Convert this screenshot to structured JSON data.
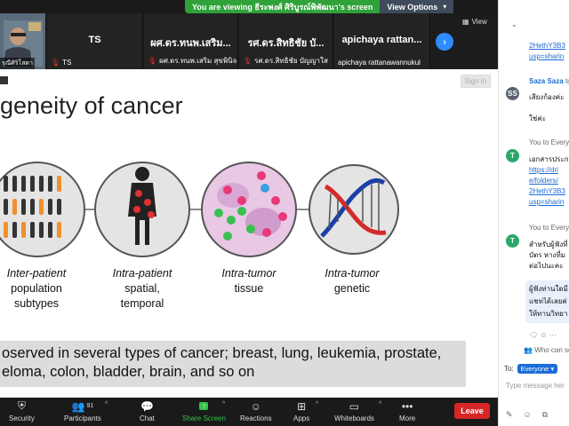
{
  "banner": {
    "text": "You are viewing ธีระพงศ์ ศิริบูรณ์พิพัฒนา's screen",
    "options": "View Options"
  },
  "participants": [
    {
      "name_big": "",
      "label": "",
      "cam_label": "รุณีศิริโสดา"
    },
    {
      "name_big": "TS",
      "label": "TS"
    },
    {
      "name_big": "ผศ.ดร.ทนพ.เสริม...",
      "label": "ผศ.ดร.ทนพ.เสริม สุขพินิจ"
    },
    {
      "name_big": "รศ.ดร.สิทธิชัย บั...",
      "label": "รศ.ดร.สิทธิชัย บัญญาใส"
    },
    {
      "name_big": "apichaya rattan...",
      "label": "apichaya rattanawannukul"
    }
  ],
  "view_label": "View",
  "slide": {
    "sign_in": "Sign in",
    "title": "geneity of cancer",
    "captions": [
      {
        "line1": "Inter-patient",
        "line2": "population",
        "line3": "subtypes"
      },
      {
        "line1": "Intra-patient",
        "line2": "spatial,",
        "line3": "temporal"
      },
      {
        "line1": "Intra-tumor",
        "line2": "tissue",
        "line3": ""
      },
      {
        "line1": "Intra-tumor",
        "line2": "genetic",
        "line3": ""
      }
    ],
    "bottom_line1": "oserved in several types of cancer; breast, lung, leukemia, prostate,",
    "bottom_line2": "eloma, colon, bladder, brain, and so on"
  },
  "toolbar": {
    "security": "Security",
    "participants": "Participants",
    "participants_count": "91",
    "chat": "Chat",
    "share": "Share Screen",
    "reactions": "Reactions",
    "apps": "Apps",
    "whiteboards": "Whiteboards",
    "more": "More",
    "leave": "Leave"
  },
  "chat": {
    "link1a": "2HethY3B3",
    "link1b": "usp=sharin",
    "sender1": "Saza Saza",
    "sender1_to": "to",
    "avatar1": "SS",
    "msg1": "เสียงก้องค่ะ",
    "msg2": "ใช่ค่ะ",
    "you_to1": "You to Every",
    "avatar2": "T",
    "msg3": "เอกสารประก",
    "link2a": "https://dri",
    "link2b": "e/folders/",
    "link2c": "2HethY3B3",
    "link2d": "usp=sharin",
    "you_to2": "You to Every",
    "avatar3": "T",
    "msg4a": "สำหรับผู้ฟังที่",
    "msg4b": "บัตร หางที่ม",
    "msg4c": "ต่อไปนะคะ",
    "msg5a": "ผู้ฟังท่านใดมี",
    "msg5b": "แชทได้เลยค่",
    "msg5c": "ให้ทานวิทยา",
    "who_can_see": "Who can see",
    "to_label": "To:",
    "to_target": "Everyone",
    "placeholder": "Type message her"
  },
  "colors": {
    "accent": "#2d8cff",
    "leave": "#d72626",
    "share": "#34c24b",
    "banner": "#2fa23a"
  }
}
